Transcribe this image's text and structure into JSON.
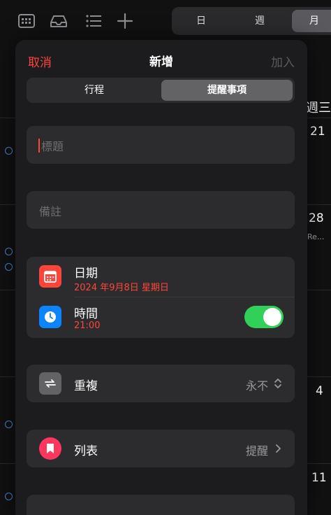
{
  "background": {
    "view_tabs": [
      "日",
      "週",
      "月"
    ],
    "active_tab": "月",
    "weekday_partial": "週三",
    "dates": [
      "21",
      "28",
      "4",
      "11"
    ],
    "event_partial": "Re..."
  },
  "sheet": {
    "cancel_label": "取消",
    "title": "新增",
    "add_label": "加入",
    "segments": [
      "行程",
      "提醒事項"
    ],
    "active_segment": "提醒事項",
    "title_placeholder": "標題",
    "notes_placeholder": "備註",
    "date_label": "日期",
    "date_value": "2024 年9月8日 星期日",
    "time_label": "時間",
    "time_value": "21:00",
    "time_enabled": true,
    "repeat_label": "重複",
    "repeat_value": "永不",
    "list_label": "列表",
    "list_value": "提醒",
    "colors": {
      "accent_red": "#ff453a",
      "calendar_icon_bg": "#ff453a",
      "clock_icon_bg": "#0a84ff",
      "repeat_icon_bg": "#636366",
      "list_icon_bg": "#ff375f",
      "toggle_on": "#30d158"
    }
  }
}
